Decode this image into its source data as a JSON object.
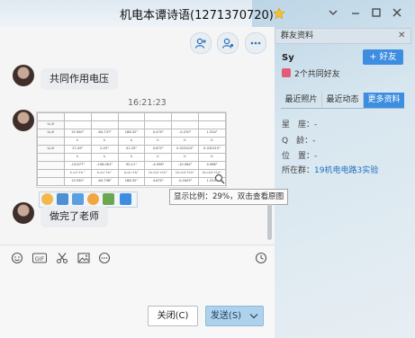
{
  "window": {
    "title": "机电本谭诗语(1271370720)"
  },
  "messages": [
    {
      "text": "共同作用电压"
    },
    {
      "time": "16:21:23"
    },
    {
      "text": "做完了老师"
    }
  ],
  "image_table": {
    "header": [
      "",
      "",
      "",
      "",
      "",
      "",
      ""
    ],
    "rows": [
      [
        "U₁/V",
        "",
        "",
        "",
        "",
        "",
        ""
      ],
      [
        "U₂/V",
        "15.900°",
        "-84.737°",
        "188.32°",
        "0.470°",
        "-0.470°",
        "1.524°"
      ],
      [
        "",
        "I₁",
        "I₂",
        "I₃",
        "I₁'",
        "I₂'",
        "I₃'"
      ],
      [
        "U₂/V",
        "27.49°",
        "0.25°",
        "41.33°",
        "0.672°",
        "0.023415°",
        "0.032415°"
      ],
      [
        "",
        "I₁",
        "I₂",
        "I₃",
        "I₁'",
        "I₂'",
        "I₃'"
      ],
      [
        "",
        "-13.877°",
        "-106.061°",
        "90.11°",
        "-4.096°",
        "-10.064°",
        "4.986°"
      ],
      [
        "",
        "I₁=I₁'+I₁''",
        "I₂=I₂'+I₂''",
        "I₃=I₃'+I₃''",
        "U₁=U₁'+U₁''",
        "U₂=U₂'+U₂''",
        "U₃=U₃'+U₃''"
      ],
      [
        "",
        "13.930°",
        "-84.798°",
        "188.32°",
        "4.670°",
        "-0.0405°",
        "1.524°"
      ]
    ]
  },
  "tooltip": "显示比例：29%，双击查看原图",
  "buttons": {
    "close": "关闭(C)",
    "send": "发送(S)"
  },
  "side_panel": {
    "header": "群友资料",
    "name": "Sy",
    "add_friend": "+ 好友",
    "mutual_groups": "2个共同好友",
    "tabs": [
      "最近照片",
      "最近动态",
      "更多资料"
    ],
    "active_tab": 2,
    "info": [
      {
        "label": "星　座：",
        "value": "-"
      },
      {
        "label": "Q　龄：",
        "value": "-"
      },
      {
        "label": "位　置：",
        "value": "-"
      },
      {
        "label": "所在群：",
        "value": "19机电电路3实验"
      }
    ]
  },
  "colors": {
    "accent": "#3d8ee0",
    "send_button": "#aed2ec",
    "link": "#1a6fbf"
  }
}
